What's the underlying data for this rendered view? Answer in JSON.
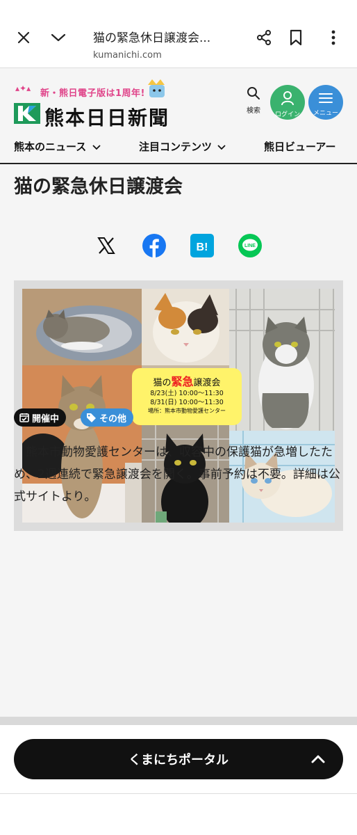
{
  "browser": {
    "title": "猫の緊急休日譲渡会...",
    "url": "kumanichi.com"
  },
  "header": {
    "banner": "新・熊日電子版は1周年!",
    "logo": "熊本日日新聞",
    "search_label": "検索",
    "login_label": "ログイン",
    "menu_label": "メニュー"
  },
  "nav": {
    "items": [
      "熊本のニュース",
      "注目コンテンツ",
      "熊日ビューアー"
    ]
  },
  "article": {
    "title": "猫の緊急休日譲渡会",
    "share": [
      "X",
      "Facebook",
      "B!",
      "LINE"
    ],
    "poster": {
      "title_pre": "猫の",
      "title_em": "緊急",
      "title_post": "譲渡会",
      "date1": "8/23(土)  10:00～11:30",
      "date2": "8/31(日)  10:00～11:30",
      "place": "場所：熊本市動物愛護センター"
    },
    "badges": {
      "status": "開催中",
      "tag": "その他"
    },
    "body": "熊本市動物愛護センターは、収容中の保護猫が急増したため、2週連続で緊急譲渡会を開く。事前予約は不要。詳細は公式サイトより。"
  },
  "footer": {
    "portal_label": "くまにちポータル"
  },
  "colors": {
    "login": "#3ab26e",
    "menu": "#3a8fd8",
    "tag": "#3a8fd8",
    "poster": "#fff36a"
  }
}
